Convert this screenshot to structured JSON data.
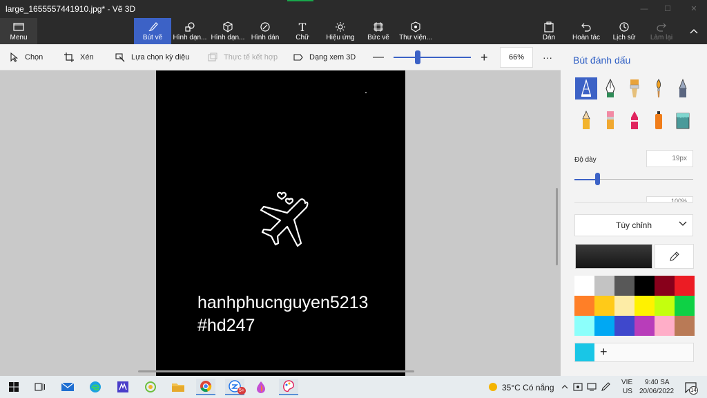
{
  "window": {
    "title": "large_1655557441910.jpg* - Vẽ 3D"
  },
  "ribbon": {
    "menu": "Menu",
    "tabs": [
      "Bút vẽ",
      "Hình dạn...",
      "Hình dạn...",
      "Hình dán",
      "Chữ",
      "Hiệu ứng",
      "Bức vẽ",
      "Thư viện..."
    ],
    "right": [
      "Dán",
      "Hoàn tác",
      "Lịch sử",
      "Làm lại"
    ]
  },
  "toolbar": {
    "select": "Chọn",
    "crop": "Xén",
    "magic_select": "Lựa chọn kỳ diệu",
    "mixed_reality": "Thực tế kết hợp",
    "view_3d": "Dạng xem 3D",
    "zoom": "66%",
    "more": "···"
  },
  "canvas": {
    "line1": "hanhphucnguyen5213",
    "line2": "#hd247"
  },
  "panel": {
    "title": "Bút đánh dấu",
    "thickness_label": "Độ dày",
    "thickness_value": "19px",
    "opacity_value": "100%",
    "dropdown": "Tùy chỉnh",
    "plus": "+",
    "swatches": [
      "#ffffff",
      "#c3c3c3",
      "#585858",
      "#000000",
      "#88001b",
      "#ec1c24",
      "#ff7f27",
      "#ffca18",
      "#fdeca6",
      "#fff200",
      "#c4ff0e",
      "#0ed145",
      "#8cfffb",
      "#00a8f3",
      "#3f48cc",
      "#b83dba",
      "#ffaec8",
      "#b97a56"
    ],
    "custom_color": "#19c6e6",
    "selected_color": "#1f1f1f"
  },
  "taskbar": {
    "weather": "35°C  Có nắng",
    "lang1": "VIE",
    "lang2": "US",
    "time": "9:40 SA",
    "date": "20/06/2022",
    "badge": "5+",
    "notifications": "14"
  }
}
